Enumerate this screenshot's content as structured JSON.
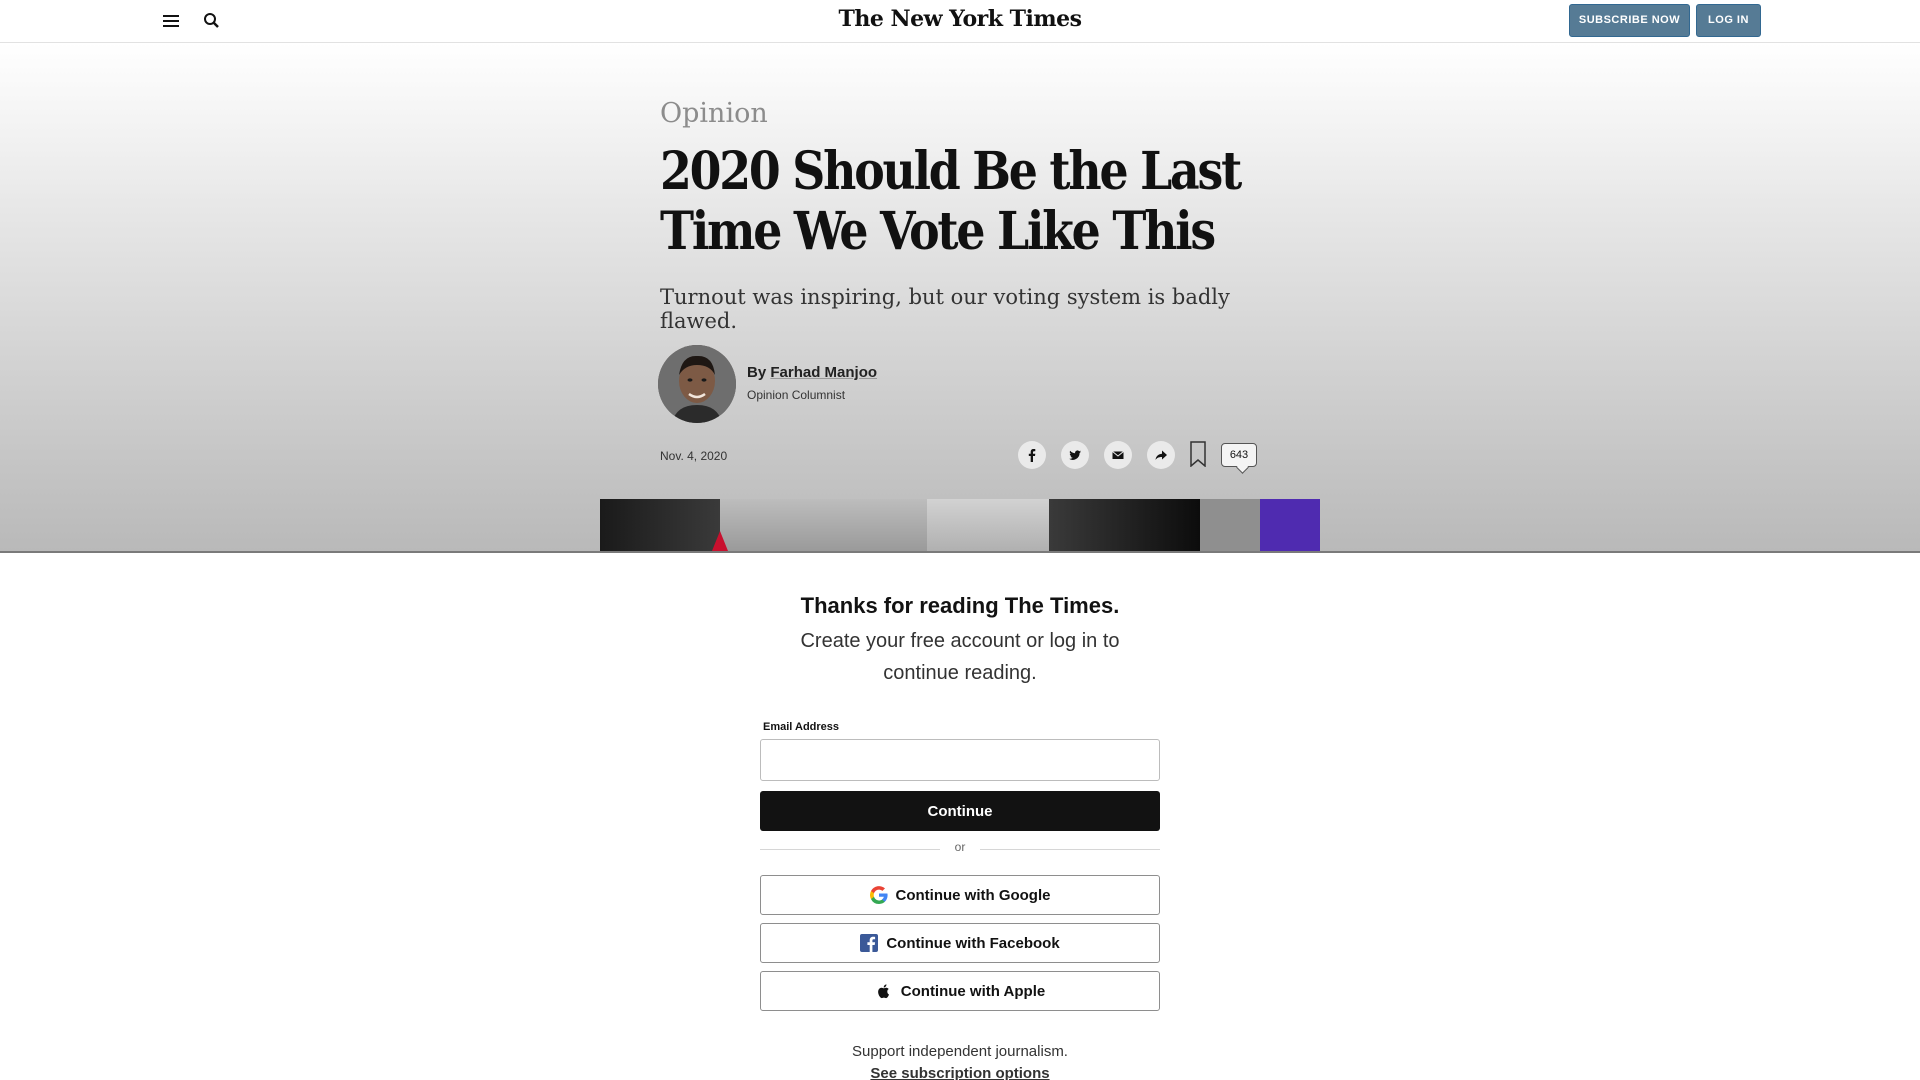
{
  "header": {
    "logo": "The New York Times",
    "subscribe_label": "SUBSCRIBE NOW",
    "login_label": "LOG IN"
  },
  "article": {
    "kicker": "Opinion",
    "headline": "2020 Should Be the Last Time We Vote Like This",
    "dek": "Turnout was inspiring, but our voting system is badly flawed.",
    "byline_prefix": "By",
    "author": "Farhad Manjoo",
    "author_role": "Opinion Columnist",
    "date": "Nov. 4, 2020",
    "comment_count": "643"
  },
  "paywall": {
    "title": "Thanks for reading The Times.",
    "subtitle": "Create your free account or log in to continue reading.",
    "email_label": "Email Address",
    "email_value": "",
    "continue_label": "Continue",
    "or_label": "or",
    "google_label": "Continue with Google",
    "facebook_label": "Continue with Facebook",
    "apple_label": "Continue with Apple",
    "support_text": "Support independent journalism.",
    "subscription_link": "See subscription options"
  },
  "colors": {
    "subscribe_button": "#567b95",
    "continue_button": "#121212",
    "facebook_blue": "#3b5998",
    "image_purple": "#4f2bb0"
  }
}
